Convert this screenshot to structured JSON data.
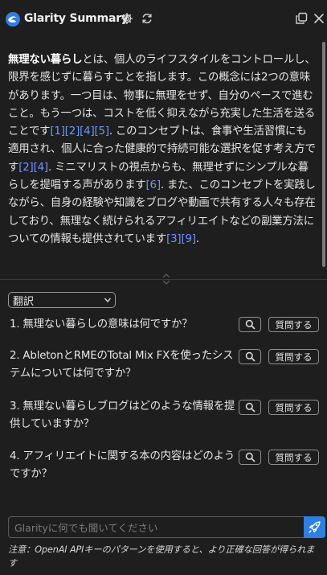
{
  "header": {
    "title": "Glarity Summary",
    "icons": [
      "glarity-logo-icon",
      "gear-icon",
      "refresh-icon",
      "popout-icon",
      "close-icon"
    ]
  },
  "summary": {
    "parts": [
      {
        "t": "無理ない暮らし",
        "s": "bold"
      },
      {
        "t": "とは、個人のライフスタイルをコントロールし、限界を感じずに暮らすことを指します。この概念には2つの意味があります。一つ目は、物事に無理をせず、自分のペースで進むこと。もう一つは、コストを低く抑えながら充実した生活を送ることです",
        "s": "text"
      },
      {
        "t": "[1]",
        "s": "cite"
      },
      {
        "t": "[2]",
        "s": "cite"
      },
      {
        "t": "[4]",
        "s": "cite"
      },
      {
        "t": "[5]",
        "s": "cite"
      },
      {
        "t": ". このコンセプトは、食事や生活習慣にも適用され、個人に合った健康的で持続可能な選択を促す考え方です",
        "s": "text"
      },
      {
        "t": "[2]",
        "s": "cite"
      },
      {
        "t": "[4]",
        "s": "cite"
      },
      {
        "t": ". ミニマリストの視点からも、無理せずにシンプルな暮らしを提唱する声があります",
        "s": "text"
      },
      {
        "t": "[6]",
        "s": "cite"
      },
      {
        "t": ". また、このコンセプトを実践しながら、自身の経験や知識をブログや動画で共有する人々も存在しており、無理なく続けられるアフィリエイトなどの副業方法についての情報も提供されています",
        "s": "text"
      },
      {
        "t": "[3]",
        "s": "cite"
      },
      {
        "t": "[9]",
        "s": "cite"
      },
      {
        "t": ".",
        "s": "text"
      }
    ]
  },
  "language_select": {
    "selected": "翻訳"
  },
  "questions": [
    {
      "text": "1. 無理ない暮らしの意味は何ですか？",
      "ask_label": "質問する"
    },
    {
      "text": "2. AbletonとRMEのTotal Mix FXを使ったシステムについては何ですか？",
      "ask_label": "質問する"
    },
    {
      "text": "3. 無理ない暮らしブログはどのような情報を提供していますか？",
      "ask_label": "質問する"
    },
    {
      "text": "4. アフィリエイトに関する本の内容はどのようですか？",
      "ask_label": "質問する"
    }
  ],
  "chat": {
    "placeholder": "Glarityに何でも聞いてください"
  },
  "note": "注意：OpenAI APIキーのパターンを使用すると、より正確な回答が得られます",
  "colors": {
    "background": "#1e1e1e",
    "citation": "#6f96ff",
    "send_button": "#2f7fe0"
  }
}
